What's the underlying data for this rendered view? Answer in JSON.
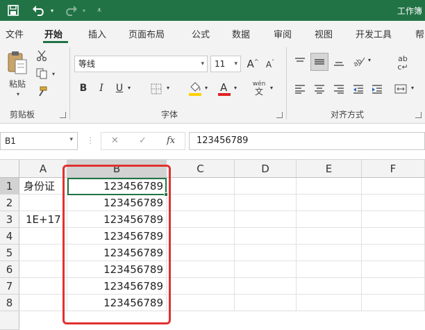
{
  "title_bar": {
    "document_title": "工作簿",
    "icons": [
      "save-icon",
      "undo-icon",
      "undo-dropdown-icon",
      "redo-icon",
      "redo-dropdown-icon",
      "customize-qat-icon"
    ]
  },
  "ribbon_tabs": [
    "文件",
    "开始",
    "插入",
    "页面布局",
    "公式",
    "数据",
    "审阅",
    "视图",
    "开发工具",
    "帮"
  ],
  "active_tab": "开始",
  "ribbon": {
    "clipboard": {
      "paste_label": "粘贴",
      "group_label": "剪贴板"
    },
    "font": {
      "font_name": "等线",
      "font_size": "11",
      "bold": "B",
      "italic": "I",
      "underline": "U",
      "phonetic": "wén",
      "group_label": "字体"
    },
    "alignment": {
      "wrap": "ab",
      "group_label": "对齐方式"
    }
  },
  "formula_bar": {
    "name_box": "B1",
    "fx": "fx",
    "value": "123456789"
  },
  "grid": {
    "columns": [
      "A",
      "B",
      "C",
      "D",
      "E",
      "F"
    ],
    "selected_column": "B",
    "rows": [
      "1",
      "2",
      "3",
      "4",
      "5",
      "6",
      "7",
      "8"
    ],
    "selected_row": "1",
    "active_cell": "B1",
    "cells": {
      "A1": "身份证",
      "A3": "1E+17",
      "B1": "123456789",
      "B2": "123456789",
      "B3": "123456789",
      "B4": "123456789",
      "B5": "123456789",
      "B6": "123456789",
      "B7": "123456789",
      "B8": "123456789"
    }
  },
  "colors": {
    "brand": "#217346",
    "highlight_box": "#e0312f",
    "fill_color": "#ffd000",
    "font_color": "#e02020"
  }
}
